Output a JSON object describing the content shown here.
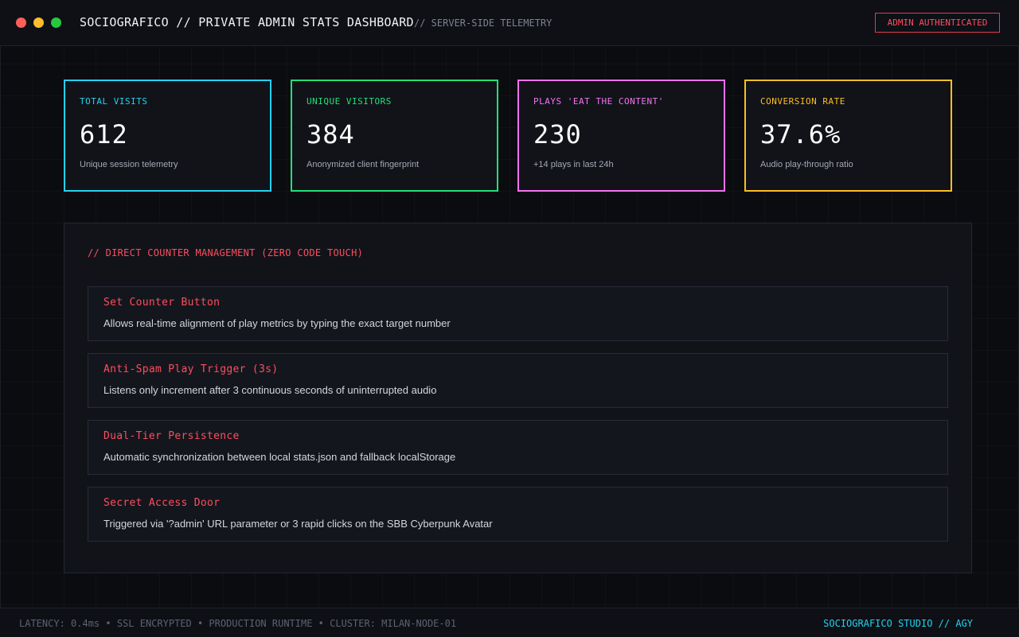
{
  "window": {
    "controls": [
      "close",
      "minimize",
      "maximize"
    ]
  },
  "header": {
    "title": "SOCIOGRAFICO // PRIVATE ADMIN STATS DASHBOARD",
    "subtitle": "// SERVER-SIDE TELEMETRY",
    "badge": "ADMIN AUTHENTICATED"
  },
  "stats": [
    {
      "label": "TOTAL VISITS",
      "value": "612",
      "caption": "Unique session telemetry",
      "color": "#22d3ee"
    },
    {
      "label": "UNIQUE VISITORS",
      "value": "384",
      "caption": "Anonymized client fingerprint",
      "color": "#22e07a"
    },
    {
      "label": "PLAYS 'EAT THE CONTENT'",
      "value": "230",
      "caption": "+14 plays in last 24h",
      "color": "#f472f0"
    },
    {
      "label": "CONVERSION RATE",
      "value": "37.6%",
      "caption": "Audio play-through ratio",
      "color": "#fbbf24"
    }
  ],
  "panel": {
    "title": "// DIRECT COUNTER MANAGEMENT (ZERO CODE TOUCH)",
    "features": [
      {
        "title": "Set Counter Button",
        "description": "Allows real-time alignment of play metrics by typing the exact target number"
      },
      {
        "title": "Anti-Spam Play Trigger (3s)",
        "description": "Listens only increment after 3 continuous seconds of uninterrupted audio"
      },
      {
        "title": "Dual-Tier Persistence",
        "description": "Automatic synchronization between local stats.json and fallback localStorage"
      },
      {
        "title": "Secret Access Door",
        "description": "Triggered via '?admin' URL parameter or 3 rapid clicks on the SBB Cyberpunk Avatar"
      }
    ]
  },
  "footer": {
    "status": "LATENCY: 0.4ms • SSL ENCRYPTED • PRODUCTION RUNTIME • CLUSTER: MILAN-NODE-01",
    "brand": "SOCIOGRAFICO STUDIO // AGY"
  },
  "colors": {
    "accent_red": "#ff4d5e",
    "accent_cyan": "#22d3ee",
    "background": "#0b0c10"
  }
}
